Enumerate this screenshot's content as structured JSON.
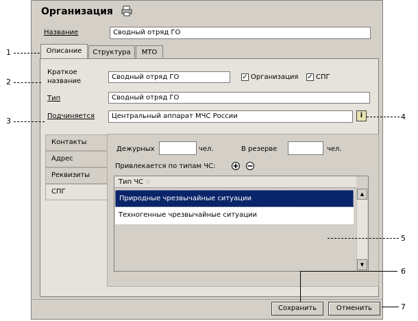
{
  "window": {
    "title": "Организация"
  },
  "name": {
    "label": "Название",
    "value": "Сводный отряд ГО"
  },
  "tabs": [
    {
      "label": "Описание"
    },
    {
      "label": "Структура"
    },
    {
      "label": "МТО"
    }
  ],
  "description": {
    "short_name_label_line1": "Краткое",
    "short_name_label_line2": "название",
    "short_name_value": "Сводный отряд ГО",
    "org_checkbox_label": "Организация",
    "spg_checkbox_label": "СПГ",
    "type_label": "Тип",
    "type_value": "Сводный отряд ГО",
    "subordinate_label": "Подчиняется",
    "subordinate_value": "Центральный аппарат МЧС России"
  },
  "side_tabs": [
    {
      "label": "Контакты"
    },
    {
      "label": "Адрес"
    },
    {
      "label": "Реквизиты"
    },
    {
      "label": "СПГ"
    }
  ],
  "spg": {
    "duty_label": "Дежурных",
    "duty_unit": "чел.",
    "reserve_label": "В резерве",
    "reserve_unit": "чел.",
    "involved_label": "Привлекается по типам ЧС:",
    "grid_header": "Тип ЧС",
    "rows": [
      "Природные чрезвычайные ситуации",
      "Техногенные чрезвычайные ситуации"
    ]
  },
  "buttons": {
    "save": "Сохранить",
    "cancel": "Отменить"
  },
  "callouts": [
    "1",
    "2",
    "3",
    "4",
    "5",
    "6",
    "7"
  ],
  "colors": {
    "selection": "#0a246a",
    "panel": "#d4d0c8"
  }
}
